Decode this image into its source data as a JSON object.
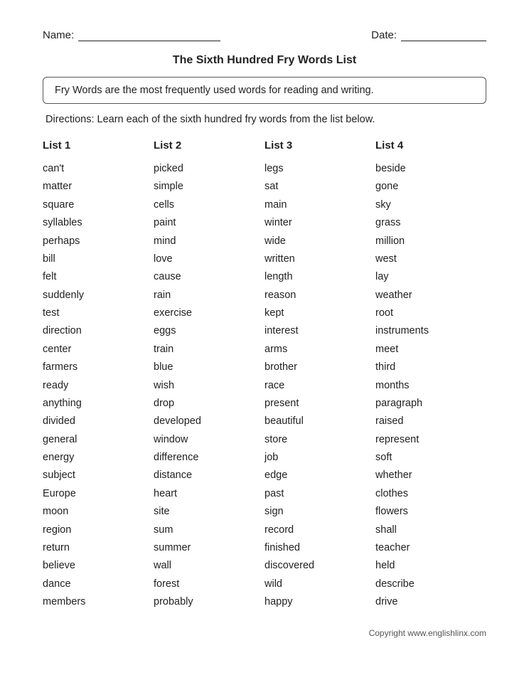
{
  "header": {
    "name_label": "Name:",
    "date_label": "Date:"
  },
  "title": "The Sixth Hundred Fry Words List",
  "description": "Fry Words are the most frequently used words for reading and writing.",
  "directions": "Directions: Learn each of the sixth hundred fry words from the list below.",
  "lists": [
    {
      "header": "List 1",
      "words": [
        "can't",
        "matter",
        "square",
        "syllables",
        "perhaps",
        "bill",
        "felt",
        "suddenly",
        "test",
        "direction",
        "center",
        "farmers",
        "ready",
        "anything",
        "divided",
        "general",
        "energy",
        "subject",
        "Europe",
        "moon",
        "region",
        "return",
        "believe",
        "dance",
        "members"
      ]
    },
    {
      "header": "List 2",
      "words": [
        "picked",
        "simple",
        "cells",
        "paint",
        "mind",
        "love",
        "cause",
        "rain",
        "exercise",
        "eggs",
        "train",
        "blue",
        "wish",
        "drop",
        "developed",
        "window",
        "difference",
        "distance",
        "heart",
        "site",
        "sum",
        "summer",
        "wall",
        "forest",
        "probably"
      ]
    },
    {
      "header": "List 3",
      "words": [
        "legs",
        "sat",
        "main",
        "winter",
        "wide",
        "written",
        "length",
        "reason",
        "kept",
        "interest",
        "arms",
        "brother",
        "race",
        "present",
        "beautiful",
        "store",
        "job",
        "edge",
        "past",
        "sign",
        "record",
        "finished",
        "discovered",
        "wild",
        "happy"
      ]
    },
    {
      "header": "List 4",
      "words": [
        "beside",
        "gone",
        "sky",
        "grass",
        "million",
        "west",
        "lay",
        "weather",
        "root",
        "instruments",
        "meet",
        "third",
        "months",
        "paragraph",
        "raised",
        "represent",
        "soft",
        "whether",
        "clothes",
        "flowers",
        "shall",
        "teacher",
        "held",
        "describe",
        "drive"
      ]
    }
  ],
  "copyright": "Copyright www.englishlinx.com"
}
